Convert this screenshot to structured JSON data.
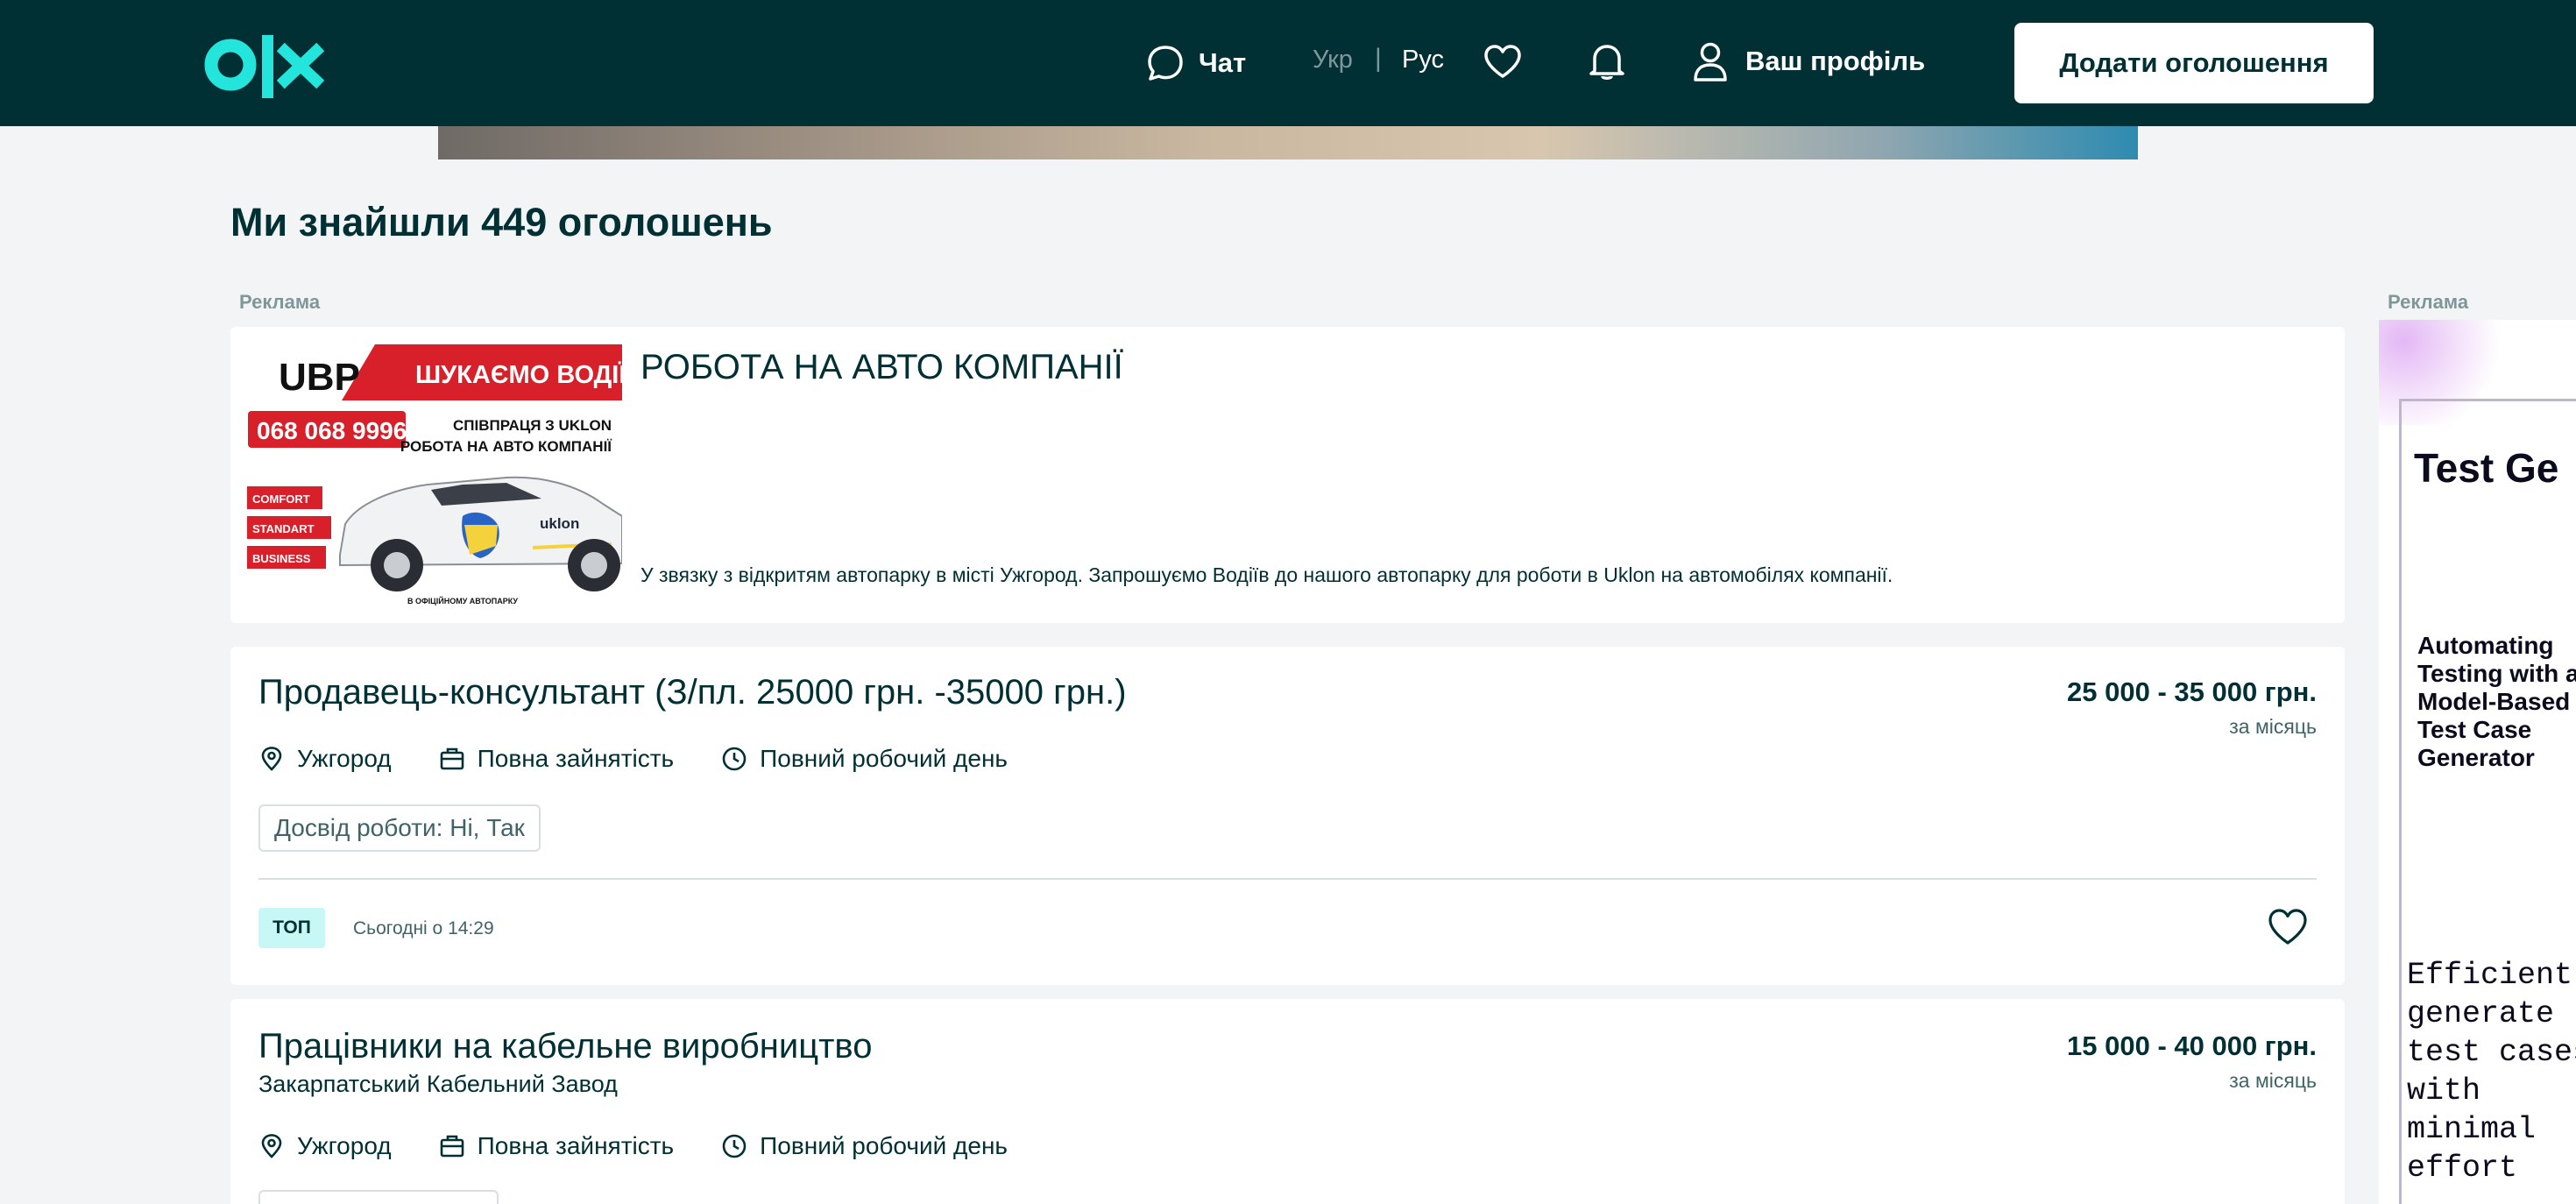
{
  "header": {
    "chat_label": "Чат",
    "lang_ukr": "Укр",
    "lang_sep": "|",
    "lang_rus": "Рус",
    "profile_label": "Ваш профіль",
    "add_button": "Додати оголошення"
  },
  "colors": {
    "header_bg": "#002f34",
    "logo": "#23e5db",
    "top_badge": "#c8f8f6",
    "page_bg": "#f2f4f5"
  },
  "page_title": "Ми знайшли 449 оголошень",
  "ad_label_left": "Реклама",
  "ad_label_right": "Реклама",
  "promo": {
    "title": "РОБОТА НА АВТО КОМПАНІЇ",
    "description": "У звязку з відкритям автопарку в місті Ужгород. Запрошуємо Водіїв до нашого автопарку для роботи в Uklon на автомобілях компанії.",
    "image": {
      "brand": "UBP",
      "headline": "ШУКАЄМО ВОДІЇВ",
      "phone": "068 068 9996",
      "line1": "СПІВПРАЦЯ З UKLON",
      "line2": "РОБОТА НА АВТО КОМПАНІЇ",
      "classes": [
        "COMFORT",
        "STANDART",
        "BUSINESS"
      ],
      "car_brand": "uklon",
      "footer": "В ОФІЦІЙНОМУ АВТОПАРКУ"
    }
  },
  "listings": [
    {
      "title": "Продавець-консультант (З/пл. 25000 грн. -35000 грн.)",
      "company": "",
      "salary": "25 000 - 35 000 грн.",
      "period": "за місяць",
      "location": "Ужгород",
      "employment": "Повна зайнятість",
      "schedule": "Повний робочий день",
      "tag": "Досвід роботи: Ні, Так",
      "badge": "ТОП",
      "date": "Сьогодні о 14:29"
    },
    {
      "title": "Працівники на кабельне виробництво",
      "company": "Закарпатський Кабельний Завод",
      "salary": "15 000 - 40 000 грн.",
      "period": "за місяць",
      "location": "Ужгород",
      "employment": "Повна зайнятість",
      "schedule": "Повний робочий день"
    }
  ],
  "side_ad": {
    "title": "Test Ge",
    "subtitle": "Automating Testing with a Model-Based Test Case Generator",
    "body": "Efficiently generate test cases with minimal effort"
  }
}
